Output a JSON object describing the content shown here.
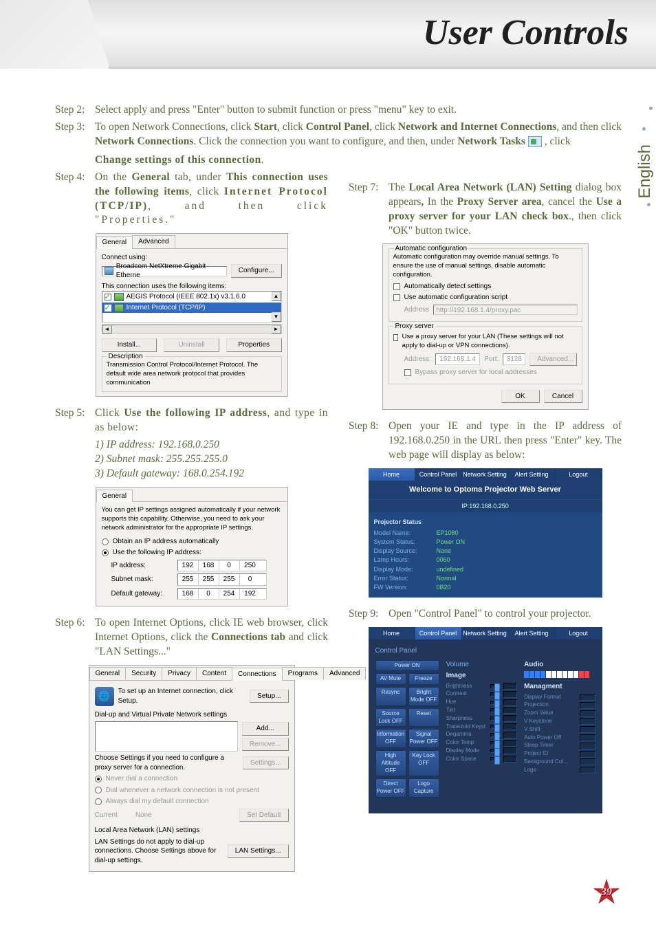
{
  "banner_title": "User Controls",
  "side_tab": "English",
  "page_number": "39",
  "step2": {
    "label": "Step 2:",
    "body_1": "Select apply and press \"Enter\" button to submit function or press \"menu\" key to exit."
  },
  "step3": {
    "label": "Step 3:",
    "body_pre": "To open Network Connections, click ",
    "b1": "Start",
    "t1": ", click ",
    "b2": "Control Panel",
    "t2": ", click ",
    "b3": "Network and Internet Connections",
    "t3": ", and then click ",
    "b4": "Network Connections",
    "t4": ". Click the connection you want to configure, and then, under ",
    "b5": "Network Tasks",
    "t5": " ",
    "after_icon": " , click ",
    "b6": "Change settings of this connection",
    "t6": "."
  },
  "step4": {
    "label": "Step 4:",
    "pre": "On the ",
    "b1": "General",
    "t1": " tab, under ",
    "b2": "This connection uses the following items",
    "t2": ", click ",
    "b3": "Internet Protocol (TCP/IP)",
    "t3": ", and then click \"Properties.\""
  },
  "step5": {
    "label": "Step 5:",
    "pre": "Click ",
    "b1": "Use the following IP address",
    "post": ", and type in as below:",
    "l1": "1) IP address: 192.168.0.250",
    "l2": "2) Subnet mask: 255.255.255.0",
    "l3": "3) Default gateway: 168.0.254.192"
  },
  "step6": {
    "label": "Step 6:",
    "pre": "To open Internet Options, click IE web browser, click Internet Options, click the ",
    "b1": "Connections tab",
    "post": " and click \"LAN Settings...\""
  },
  "step7": {
    "label": "Step 7:",
    "pre": "The ",
    "b1": "Local Area Network (LAN) Setting",
    "t1": " dialog box appears",
    "comma_bold": ",",
    "t1b": " In the ",
    "b2": "Proxy Server area",
    "t2": ", cancel the ",
    "b3": "Use a proxy server for your LAN check box",
    "t3": "., then click \"OK\" button twice."
  },
  "step8": {
    "label": "Step 8:",
    "body": "Open your IE and type in the IP address of 192.168.0.250 in the URL then press \"Enter\" key. The web page will display as below:"
  },
  "step9": {
    "label": "Step 9:",
    "body": "Open \"Control Panel\" to control your projector."
  },
  "general_panel": {
    "tab_general": "General",
    "tab_advanced": "Advanced",
    "connect_using": "Connect using:",
    "adapter": "Broadcom NetXtreme Gigabit Etherne",
    "configure": "Configure...",
    "uses_label": "This connection uses the following items:",
    "item1": "AEGIS Protocol (IEEE 802.1x) v3.1.6.0",
    "item2": "Internet Protocol (TCP/IP)",
    "install": "Install...",
    "uninstall": "Uninstall",
    "properties": "Properties",
    "desc_title": "Description",
    "desc_text": "Transmission Control Protocol/Internet Protocol. The default wide area network protocol that provides communication"
  },
  "tcp_panel": {
    "tab": "General",
    "intro": "You can get IP settings assigned automatically if your network supports this capability. Otherwise, you need to ask your network administrator for the appropriate IP settings.",
    "opt_auto": "Obtain an IP address automatically",
    "opt_manual": "Use the following IP address:",
    "ip_label": "IP address:",
    "mask_label": "Subnet mask:",
    "gw_label": "Default gateway:",
    "ip": [
      "192",
      "168",
      "0",
      "250"
    ],
    "mask": [
      "255",
      "255",
      "255",
      "0"
    ],
    "gw": [
      "168",
      "0",
      "254",
      "192"
    ]
  },
  "io_panel": {
    "tabs": [
      "General",
      "Security",
      "Privacy",
      "Content",
      "Connections",
      "Programs",
      "Advanced"
    ],
    "setup_text": "To set up an Internet connection, click Setup.",
    "setup_btn": "Setup...",
    "section_title": "Dial-up and Virtual Private Network settings",
    "add": "Add...",
    "remove": "Remove...",
    "settings": "Settings...",
    "choose_text": "Choose Settings if you need to configure a proxy server for a connection.",
    "r1": "Never dial a connection",
    "r2": "Dial whenever a network connection is not present",
    "r3": "Always dial my default connection",
    "current": "Current",
    "none": "None",
    "set_default": "Set Default",
    "lan_title": "Local Area Network (LAN) settings",
    "lan_text": "LAN Settings do not apply to dial-up connections. Choose Settings above for dial-up settings.",
    "lan_btn": "LAN Settings..."
  },
  "lan_panel": {
    "sec1": "Automatic configuration",
    "sec1_text": "Automatic configuration may override manual settings. To ensure the use of manual settings, disable automatic configuration.",
    "c1": "Automatically detect settings",
    "c2": "Use automatic configuration script",
    "addr_lbl": "Address",
    "addr_val": "http://192.168.1.4/proxy.pac",
    "sec2": "Proxy server",
    "sec2_text": "Use a proxy server for your LAN (These settings will not apply to dial-up or VPN connections).",
    "addr2": "Address:",
    "ip": "192.168.1.4",
    "port_lbl": "Port:",
    "port": "3128",
    "adv": "Advanced...",
    "bypass": "Bypass proxy server for local addresses",
    "ok": "OK",
    "cancel": "Cancel"
  },
  "pws": {
    "tabs": [
      "Home",
      "Control Panel",
      "Network Setting",
      "Alert Setting",
      "Logout"
    ],
    "welcome": "Welcome to Optoma Projector Web Server",
    "ip": "IP:192.168.0.250",
    "status_title": "Projector Status",
    "rows": [
      {
        "l": "Model Name:",
        "v": "EP1080"
      },
      {
        "l": "System Status:",
        "v": "Power ON"
      },
      {
        "l": "Display Source:",
        "v": "None"
      },
      {
        "l": "Lamp Hours:",
        "v": "0060"
      },
      {
        "l": "Display Mode:",
        "v": "undefined"
      },
      {
        "l": "Error Status:",
        "v": "Normal"
      },
      {
        "l": "FW Version:",
        "v": "0B20"
      }
    ]
  },
  "cp": {
    "tabs": [
      "Home",
      "Control Panel",
      "Network Setting",
      "Alert Setting",
      "Logout"
    ],
    "title": "Control Panel",
    "left_buttons": [
      "Power ON",
      "AV Mute",
      "Resync",
      "Source Lock OFF",
      "Information OFF",
      "High Altitude OFF",
      "Direct Power OFF"
    ],
    "left_buttons2": [
      "",
      "Freeze",
      "Bright Mode OFF",
      "Reset",
      "Signal Power OFF",
      "Key Lock OFF",
      "Logo Capture"
    ],
    "volume_title": "Volume",
    "image_title": "Image",
    "image_rows": [
      "Brightness",
      "Contrast",
      "Hue",
      "Tint",
      "Sharpness",
      "Trapezoid Keyst",
      "Degamma",
      "Color Temp",
      "Display Mode",
      "Color Space"
    ],
    "audio_title": "Audio",
    "mgmt_title": "Managment",
    "mgmt_rows": [
      "Display Format",
      "Projection",
      "Zoom Value",
      "V Keystone",
      "V Shift",
      "Auto Power Off",
      "Sleep Timer",
      "Project ID",
      "Background Col...",
      "Logo"
    ]
  }
}
